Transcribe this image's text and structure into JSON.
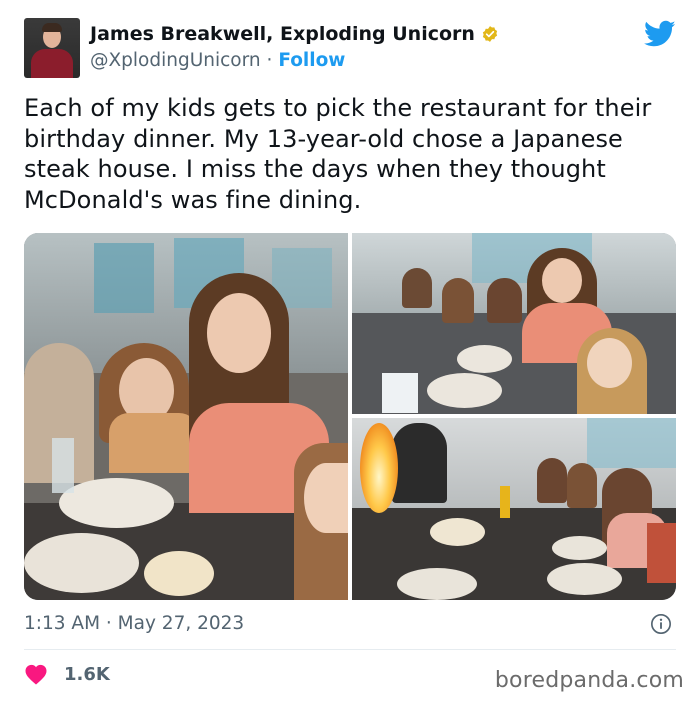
{
  "author": {
    "display_name": "James Breakwell, Exploding Unicorn",
    "handle": "@XplodingUnicorn",
    "separator": "·",
    "follow_label": "Follow"
  },
  "tweet": {
    "text": "Each of my kids gets to pick the restaurant for their birthday dinner. My 13-year-old chose a Japanese steak house. I miss the days when they thought McDonald's was fine dining.",
    "timestamp": "1:13 AM · May 27, 2023",
    "likes": "1.6K"
  },
  "watermark": "boredpanda.com",
  "icons": {
    "verified": "verified-badge-icon",
    "brand": "twitter-bird-icon",
    "info": "info-icon",
    "like": "heart-icon"
  },
  "colors": {
    "accent": "#1d9bf0",
    "verified_gold": "#e2b719",
    "heart": "#f91880",
    "muted_text": "#536471"
  }
}
